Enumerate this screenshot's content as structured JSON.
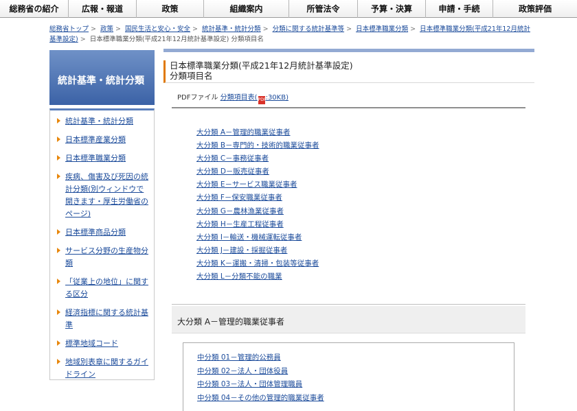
{
  "topnav": {
    "items": [
      {
        "label": "総務省の紹介"
      },
      {
        "label": "広報・報道"
      },
      {
        "label": "政策"
      },
      {
        "label": "組織案内"
      },
      {
        "label": "所管法令"
      },
      {
        "label": "予算・決算"
      },
      {
        "label": "申請・手続"
      },
      {
        "label": "政策評価"
      }
    ]
  },
  "breadcrumb": {
    "links": [
      "総務省トップ",
      "政策",
      "国民生活と安心・安全",
      "統計基準・統計分類",
      "分類に関する統計基準等",
      "日本標準職業分類",
      "日本標準職業分類(平成21年12月統計基準設定)"
    ],
    "current": "日本標準職業分類(平成21年12月統計基準設定) 分類項目名"
  },
  "sidebar": {
    "title": "統計基準・統計分類",
    "items": [
      {
        "label": "統計基準・統計分類"
      },
      {
        "label": "日本標準産業分類"
      },
      {
        "label": "日本標準職業分類"
      },
      {
        "label": "疾病、傷害及び死因の統計分類(別ウィンドウで開きます・厚生労働省のページ)"
      },
      {
        "label": "日本標準商品分類"
      },
      {
        "label": "サービス分野の生産物分類"
      },
      {
        "label": "「従業上の地位」に関する区分"
      },
      {
        "label": "経済指標に関する統計基準"
      },
      {
        "label": "標準地域コード"
      },
      {
        "label": "地域別表章に関するガイドライン"
      }
    ]
  },
  "main": {
    "title_line1": "日本標準職業分類(平成21年12月統計基準設定)",
    "title_line2": "分類項目名",
    "pdf_label": "PDFファイル",
    "pdf_link": "分類項目表(",
    "pdf_icon_text": "PDF",
    "pdf_size": ":30KB)",
    "major_categories": [
      "大分類 A－管理的職業従事者",
      "大分類 B－専門的・技術的職業従事者",
      "大分類 C－事務従事者",
      "大分類 D－販売従事者",
      "大分類 E－サービス職業従事者",
      "大分類 F－保安職業従事者",
      "大分類 G－農林漁業従事者",
      "大分類 H－生産工程従事者",
      "大分類 I－輸送・機械運転従事者",
      "大分類 J－建設・採掘従事者",
      "大分類 K－運搬・清掃・包装等従事者",
      "大分類 L－分類不能の職業"
    ],
    "section_heading": "大分類 A－管理的職業従事者",
    "sub_categories": [
      "中分類 01－管理的公務員",
      "中分類 02－法人・団体役員",
      "中分類 03－法人・団体管理職員",
      "中分類 04－その他の管理的職業従事者"
    ]
  }
}
